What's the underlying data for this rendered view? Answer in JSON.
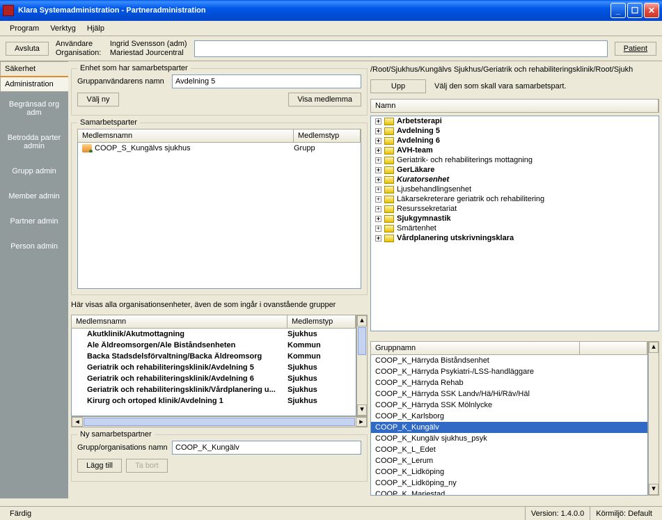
{
  "title": "Klara Systemadministration - Partneradministration",
  "menu": {
    "program": "Program",
    "verktyg": "Verktyg",
    "hjalp": "Hjälp"
  },
  "toolbar": {
    "avsluta": "Avsluta",
    "anvandare_label": "Användare",
    "anvandare_value": "Ingrid Svensson (adm)",
    "organisation_label": "Organisation:",
    "organisation_value": "Mariestad Jourcentral",
    "patient": "Patient"
  },
  "tabs": {
    "sakerhet": "Säkerhet",
    "administration": "Administration"
  },
  "sidebar": [
    "Begränsad org adm",
    "Betrodda parter admin",
    "Grupp admin",
    "Member admin",
    "Partner admin",
    "Person admin"
  ],
  "enhet": {
    "legend": "Enhet som har samarbetsparter",
    "grupp_label": "Gruppanvändarens namn",
    "grupp_value": "Avdelning 5",
    "valj_ny": "Välj ny",
    "visa_medlemma": "Visa medlemma"
  },
  "samarbetsparter": {
    "legend": "Samarbetsparter",
    "col1": "Medlemsnamn",
    "col2": "Medlemstyp",
    "rows": [
      {
        "name": "COOP_S_Kungälvs sjukhus",
        "type": "Grupp"
      }
    ]
  },
  "org_units": {
    "info": "Här visas alla organisationsenheter, även de som ingår i ovanstående grupper",
    "col1": "Medlemsnamn",
    "col2": "Medlemstyp",
    "rows": [
      {
        "name": "Akutklinik/Akutmottagning",
        "type": "Sjukhus"
      },
      {
        "name": "Ale Äldreomsorgen/Ale Biståndsenheten",
        "type": "Kommun"
      },
      {
        "name": "Backa Stadsdelsförvaltning/Backa Äldreomsorg",
        "type": "Kommun"
      },
      {
        "name": "Geriatrik och rehabiliteringsklinik/Avdelning 5",
        "type": "Sjukhus"
      },
      {
        "name": "Geriatrik och rehabiliteringsklinik/Avdelning 6",
        "type": "Sjukhus"
      },
      {
        "name": "Geriatrik och rehabiliteringsklinik/Vårdplanering u...",
        "type": "Sjukhus"
      },
      {
        "name": "Kirurg och ortoped klinik/Avdelning 1",
        "type": "Sjukhus"
      }
    ]
  },
  "ny_partner": {
    "legend": "Ny samarbetspartner",
    "label": "Grupp/organisations namn",
    "value": "COOP_K_Kungälv",
    "lagg_till": "Lägg till",
    "ta_bort": "Ta bort"
  },
  "breadcrumb": "/Root/Sjukhus/Kungälvs Sjukhus/Geriatrik och rehabiliteringsklinik/Root/Sjukh",
  "upp": "Upp",
  "upp_hint": "Välj den som skall vara samarbetspart.",
  "namn_col": "Namn",
  "tree": [
    {
      "label": "Arbetsterapi",
      "bold": true
    },
    {
      "label": "Avdelning 5",
      "bold": true
    },
    {
      "label": "Avdelning 6",
      "bold": true
    },
    {
      "label": "AVH-team",
      "bold": true
    },
    {
      "label": "Geriatrik- och rehabiliterings mottagning",
      "bold": false
    },
    {
      "label": "GerLäkare",
      "bold": true
    },
    {
      "label": "Kuratorsenhet",
      "bold": true,
      "italic": true
    },
    {
      "label": "Ljusbehandlingsenhet",
      "bold": false
    },
    {
      "label": "Läkarsekreterare geriatrik och rehabilitering",
      "bold": false
    },
    {
      "label": "Resurssekretariat",
      "bold": false
    },
    {
      "label": "Sjukgymnastik",
      "bold": true
    },
    {
      "label": "Smärtenhet",
      "bold": false
    },
    {
      "label": "Vårdplanering utskrivningsklara",
      "bold": true
    }
  ],
  "gruppnamn_col": "Gruppnamn",
  "gruppnamn": [
    "COOP_K_Härryda Biståndsenhet",
    "COOP_K_Härryda Psykiatri-/LSS-handläggare",
    "COOP_K_Härryda Rehab",
    "COOP_K_Härryda SSK Landv/Hä/Hi/Räv/Häl",
    "COOP_K_Härryda SSK Mölnlycke",
    "COOP_K_Karlsborg",
    "COOP_K_Kungälv",
    "COOP_K_Kungälv sjukhus_psyk",
    "COOP_K_L_Edet",
    "COOP_K_Lerum",
    "COOP_K_Lidköping",
    "COOP_K_Lidköping_ny",
    "COOP_K_Mariestad"
  ],
  "gruppnamn_selected_index": 6,
  "status": {
    "left": "Färdig",
    "version": "Version: 1.4.0.0",
    "env": "Körmiljö: Default"
  }
}
